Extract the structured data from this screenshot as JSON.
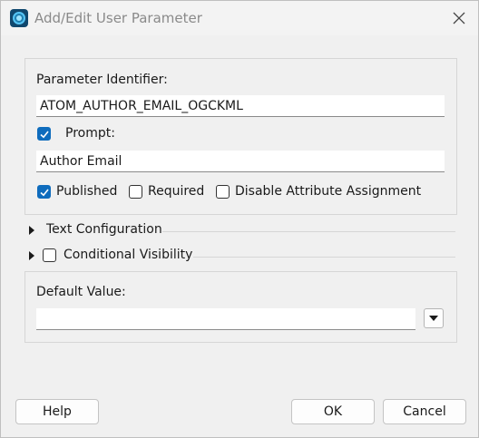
{
  "window": {
    "title": "Add/Edit User Parameter",
    "icon": "fme-workbench-icon"
  },
  "parameter": {
    "identifier_label": "Parameter Identifier:",
    "identifier_value": "ATOM_AUTHOR_EMAIL_OGCKML",
    "prompt_label": "Prompt:",
    "prompt_checked": true,
    "prompt_value": "Author Email"
  },
  "options": {
    "published_label": "Published",
    "published_checked": true,
    "required_label": "Required",
    "required_checked": false,
    "disable_attr_label": "Disable Attribute Assignment",
    "disable_attr_checked": false
  },
  "sections": {
    "text_config_label": "Text Configuration",
    "conditional_visibility_label": "Conditional Visibility",
    "conditional_visibility_checked": false
  },
  "default_value": {
    "label": "Default Value:",
    "value": ""
  },
  "buttons": {
    "help": "Help",
    "ok": "OK",
    "cancel": "Cancel"
  },
  "colors": {
    "accent": "#0f6cbd",
    "dialog_bg": "#f0f0f0"
  }
}
